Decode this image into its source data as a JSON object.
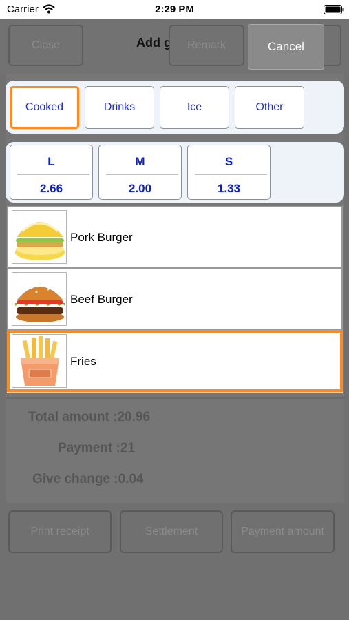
{
  "status_bar": {
    "carrier": "Carrier",
    "time": "2:29 PM"
  },
  "background": {
    "close_label": "Close",
    "title": "Add goods",
    "remark_label": "Remark",
    "total_label": "Total amount :",
    "total_value": "20.96",
    "payment_label": "Payment :",
    "payment_value": "21",
    "change_label": "Give change :",
    "change_value": "0.04",
    "print_label": "Print receipt",
    "settlement_label": "Settlement",
    "payment_amount_label": "Payment amount"
  },
  "cancel_label": "Cancel",
  "categories": [
    {
      "label": "Cooked",
      "selected": true
    },
    {
      "label": "Drinks",
      "selected": false
    },
    {
      "label": "Ice",
      "selected": false
    },
    {
      "label": "Other",
      "selected": false
    }
  ],
  "sizes": [
    {
      "label": "L",
      "price": "2.66"
    },
    {
      "label": "M",
      "price": "2.00"
    },
    {
      "label": "S",
      "price": "1.33"
    }
  ],
  "goods": [
    {
      "name": "Pork Burger",
      "icon": "pork-burger-image",
      "selected": false
    },
    {
      "name": "Beef Burger",
      "icon": "beef-burger-image",
      "selected": false
    },
    {
      "name": "Fries",
      "icon": "fries-image",
      "selected": true
    }
  ],
  "colors": {
    "accent_selected": "#ff8a1f",
    "button_text": "#1f2fd6",
    "panel_bg": "#edf3f8"
  }
}
